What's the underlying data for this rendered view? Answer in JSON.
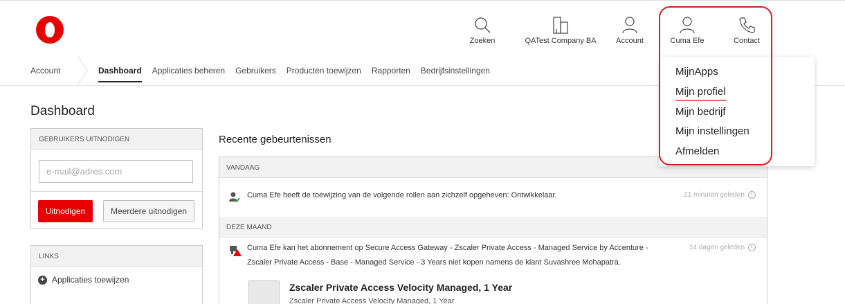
{
  "header": {
    "util_items": [
      {
        "label": "Zoeken",
        "icon": "search-icon"
      },
      {
        "label": "QATest Company BA",
        "icon": "building-icon"
      },
      {
        "label": "Account",
        "icon": "user-icon"
      },
      {
        "label": "Cuma Efe",
        "icon": "user-icon"
      },
      {
        "label": "Contact",
        "icon": "phone-icon"
      }
    ],
    "brand_color": "#e60000"
  },
  "nav": {
    "crumb": "Account",
    "items": [
      "Dashboard",
      "Applicaties beheren",
      "Gebruikers",
      "Producten toewijzen",
      "Rapporten",
      "Bedrijfsinstellingen"
    ]
  },
  "dropdown": {
    "items": [
      "MijnApps",
      "Mijn profiel",
      "Mijn bedrijf",
      "Mijn instellingen",
      "Afmelden"
    ]
  },
  "page": {
    "title": "Dashboard"
  },
  "invite": {
    "heading": "GEBRUIKERS UITNODIGEN",
    "email_placeholder": "e-mail@adres.com",
    "invite_button": "Uitnodigen",
    "multi_button": "Meerdere uitnodigen"
  },
  "links": {
    "heading": "LINKS",
    "items": [
      "Applicaties toewijzen"
    ]
  },
  "events": {
    "title": "Recente gebeurtenissen",
    "today_label": "VANDAAG",
    "event1_text": "Cuma Efe heeft de toewijzing van de volgende rollen aan zichzelf opgeheven: Ontwikkelaar.",
    "event1_time": "21 minuten geleden",
    "month_label": "DEZE MAAND",
    "event2_line1": "Cuma Efe kan het abonnement op Secure Access Gateway - Zscaler Private Access - Managed Service by Accenture -",
    "event2_line2": "Zscaler Private Access - Base - Managed Service - 3 Years niet kopen namens de klant Suvashree Mohapatra.",
    "event2_time": "14 dagen geleden",
    "product_title": "Zscaler Private Access Velocity Managed, 1 Year",
    "product_sub": "Zscaler Private Access Velocity Managed, 1 Year"
  }
}
